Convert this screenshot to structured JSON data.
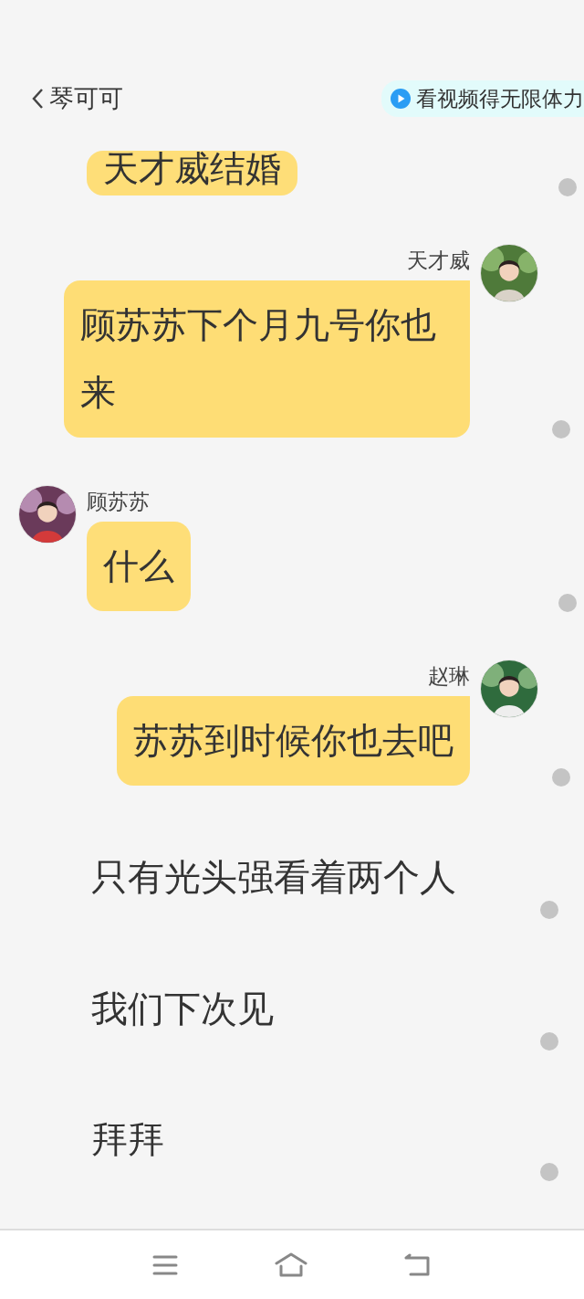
{
  "header": {
    "title": "琴可可",
    "promo": "看视频得无限体力"
  },
  "messages": [
    {
      "kind": "bubble",
      "outgoing": false,
      "text": "天才威结婚"
    },
    {
      "kind": "bubble",
      "outgoing": true,
      "sender": "天才威",
      "text": "顾苏苏下个月九号你也来"
    },
    {
      "kind": "bubble",
      "outgoing": false,
      "sender": "顾苏苏",
      "text": "什么"
    },
    {
      "kind": "bubble",
      "outgoing": true,
      "sender": "赵琳",
      "text": "苏苏到时候你也去吧"
    },
    {
      "kind": "narration",
      "text": "只有光头强看着两个人"
    },
    {
      "kind": "narration",
      "text": "我们下次见"
    },
    {
      "kind": "narration",
      "text": "拜拜"
    }
  ]
}
